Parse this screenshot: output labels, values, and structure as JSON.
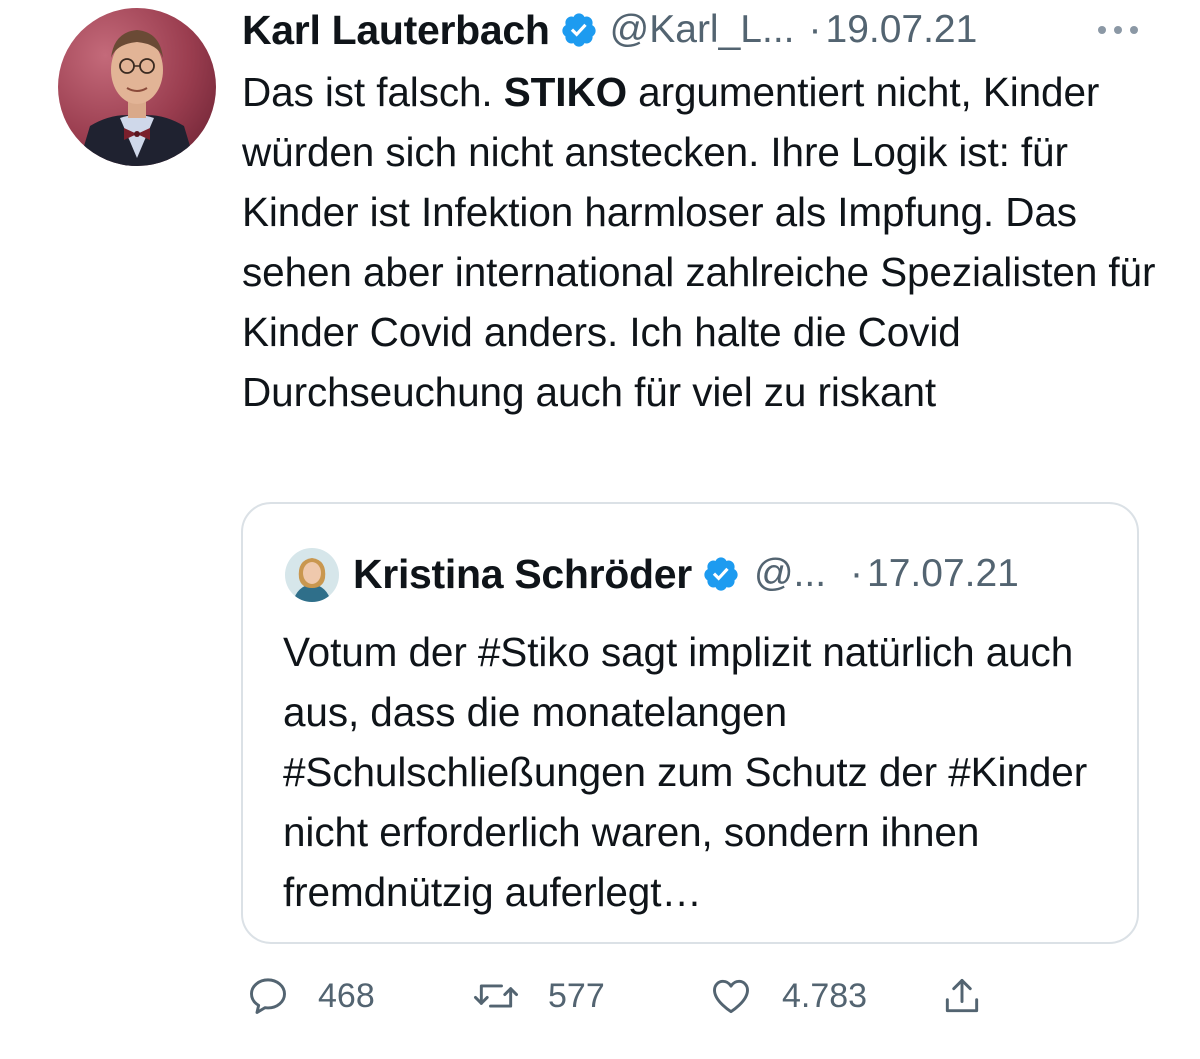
{
  "tweet": {
    "author": {
      "name": "Karl Lauterbach",
      "handle": "@Karl_L...",
      "verified": true
    },
    "dot": "·",
    "date": "19.07.21",
    "text_parts": {
      "before": "Das ist falsch. ",
      "bold": "STIKO",
      "after": " argumentiert nicht, Kinder würden sich nicht anstecken. Ihre Logik ist: für Kinder ist Infektion harmloser als Impfung. Das sehen aber international zahlreiche Spezialisten für Kinder Covid anders. Ich halte die Covid Durchseuchung auch für viel zu riskant"
    }
  },
  "quoted_tweet": {
    "author": {
      "name": "Kristina Schröder",
      "handle": "@...",
      "verified": true
    },
    "dot": "·",
    "date": "17.07.21",
    "text": "Votum der #Stiko sagt implizit natürlich auch aus, dass die monatelangen #Schulschließungen zum Schutz der #Kinder nicht erforderlich waren, sondern ihnen fremdnützig auferlegt…"
  },
  "actions": {
    "replies": "468",
    "retweets": "577",
    "likes": "4.783"
  },
  "icons": {
    "verified": "verified-badge-icon",
    "more": "more-dots-icon",
    "reply": "reply-icon",
    "retweet": "retweet-icon",
    "like": "heart-icon",
    "share": "share-icon"
  },
  "colors": {
    "text": "#0f1419",
    "secondary": "#536471",
    "verified": "#1d9bf0",
    "border": "#dbe1e6"
  }
}
